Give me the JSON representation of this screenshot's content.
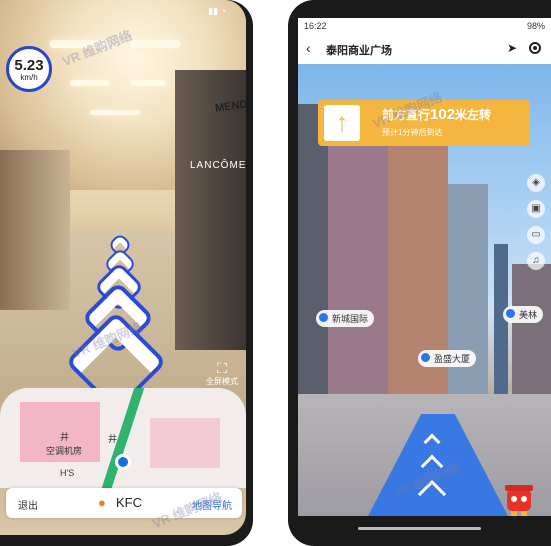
{
  "left_phone": {
    "speed": {
      "value": "5.23",
      "unit": "km/h"
    },
    "store_sign": "LANCÔME",
    "store_sign_2": "MENDE",
    "fullscreen_label": "全屏模式",
    "map": {
      "labels": [
        "井",
        "井",
        "空调机房",
        "H'S"
      ]
    },
    "bottom_bar": {
      "exit_label": "退出",
      "destination": "KFC",
      "nav_label": "地图导航"
    }
  },
  "right_phone": {
    "status": {
      "time": "16:22",
      "battery": "98%"
    },
    "header": {
      "title": "泰阳商业广场"
    },
    "banner": {
      "main_prefix": "前方直行",
      "distance": "102",
      "main_suffix": "米左转",
      "sub": "预计1分钟后到达"
    },
    "pois": [
      "新城国际",
      "盈盛大厦",
      "美林"
    ]
  },
  "watermark": "VR 维购网络",
  "colors": {
    "accent_blue": "#2846c9",
    "banner_orange": "#f4b63f",
    "route_green": "#2fb36f",
    "lane_blue": "#2f74e6",
    "nav_link": "#2f6fd6"
  }
}
